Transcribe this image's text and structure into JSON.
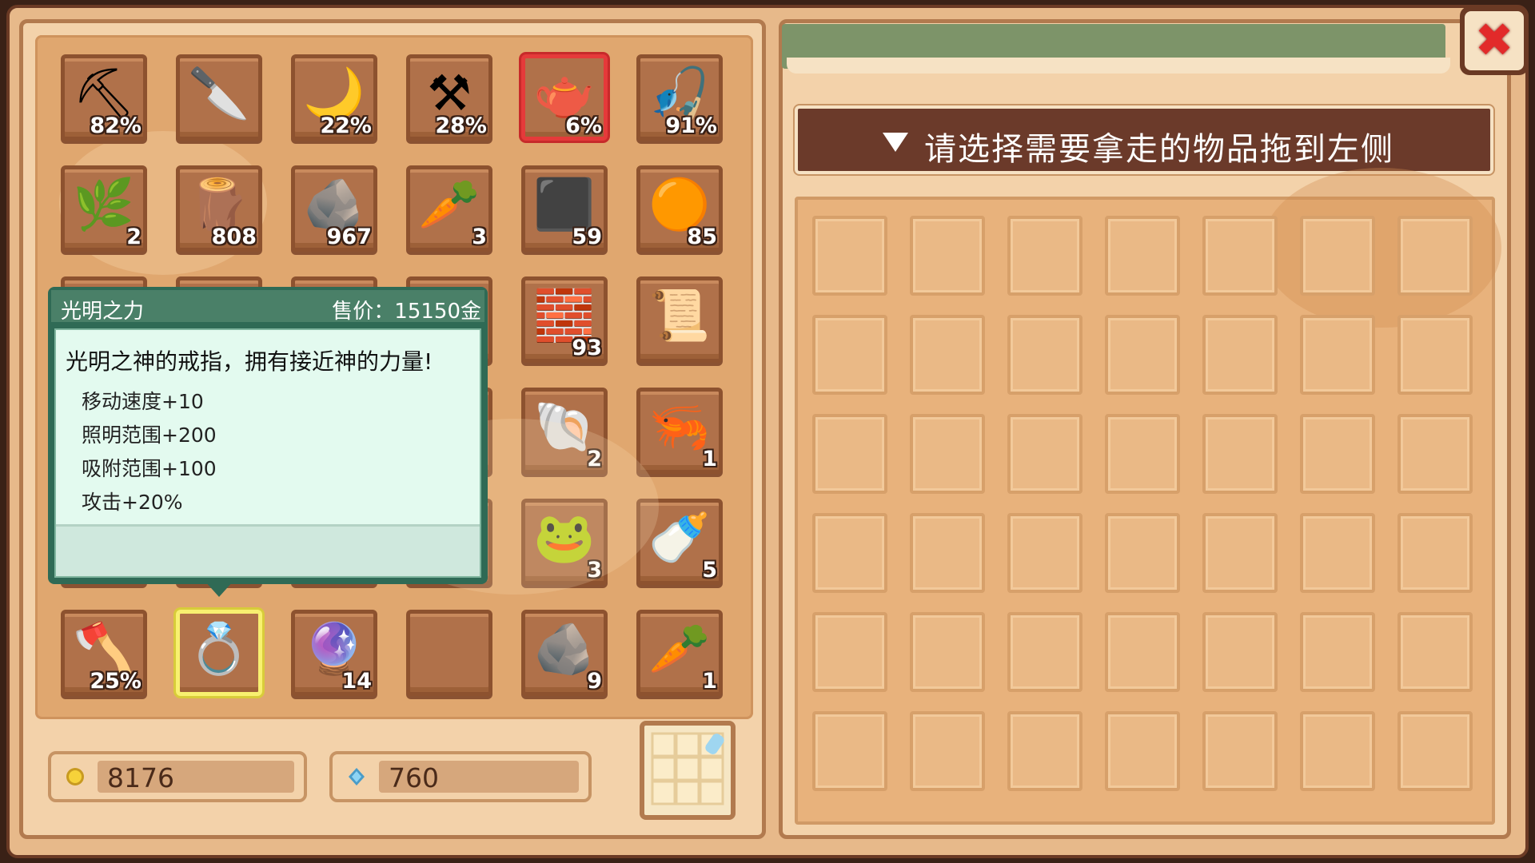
{
  "inventory": {
    "rows": [
      [
        {
          "icon": "pickaxe-icon",
          "glyph": "⛏",
          "qty": "82%",
          "highlight": ""
        },
        {
          "icon": "red-knife-icon",
          "glyph": "🔪",
          "qty": "",
          "highlight": ""
        },
        {
          "icon": "scythe-icon",
          "glyph": "🌙",
          "qty": "22%",
          "highlight": ""
        },
        {
          "icon": "hoe-icon",
          "glyph": "⚒",
          "qty": "28%",
          "highlight": ""
        },
        {
          "icon": "watering-can-icon",
          "glyph": "🫖",
          "qty": "6%",
          "highlight": "red"
        },
        {
          "icon": "fishing-rod-icon",
          "glyph": "🎣",
          "qty": "91%",
          "highlight": ""
        }
      ],
      [
        {
          "icon": "green-vine-icon",
          "glyph": "🌿",
          "qty": "2",
          "highlight": ""
        },
        {
          "icon": "wood-log-icon",
          "glyph": "🪵",
          "qty": "808",
          "highlight": ""
        },
        {
          "icon": "stone-icon",
          "glyph": "🪨",
          "qty": "967",
          "highlight": ""
        },
        {
          "icon": "parsnip-icon",
          "glyph": "🥕",
          "qty": "3",
          "highlight": ""
        },
        {
          "icon": "coal-ore-icon",
          "glyph": "⬛",
          "qty": "59",
          "highlight": ""
        },
        {
          "icon": "copper-ore-icon",
          "glyph": "🟠",
          "qty": "85",
          "highlight": ""
        }
      ],
      [
        {
          "icon": "hidden-slot",
          "glyph": "",
          "qty": "",
          "highlight": ""
        },
        {
          "icon": "hidden-slot",
          "glyph": "",
          "qty": "",
          "highlight": ""
        },
        {
          "icon": "hidden-slot",
          "glyph": "",
          "qty": "",
          "highlight": ""
        },
        {
          "icon": "hidden-slot",
          "glyph": "",
          "qty": "",
          "highlight": ""
        },
        {
          "icon": "wood-plank-icon",
          "glyph": "🧱",
          "qty": "93",
          "highlight": ""
        },
        {
          "icon": "cloth-icon",
          "glyph": "📜",
          "qty": "",
          "highlight": ""
        }
      ],
      [
        {
          "icon": "hidden-slot",
          "glyph": "",
          "qty": "",
          "highlight": ""
        },
        {
          "icon": "hidden-slot",
          "glyph": "",
          "qty": "",
          "highlight": ""
        },
        {
          "icon": "hidden-slot",
          "glyph": "",
          "qty": "",
          "highlight": ""
        },
        {
          "icon": "hidden-slot",
          "glyph": "",
          "qty": "",
          "highlight": ""
        },
        {
          "icon": "crystal-shell-icon",
          "glyph": "🐚",
          "qty": "2",
          "highlight": ""
        },
        {
          "icon": "shrimp-icon",
          "glyph": "🦐",
          "qty": "1",
          "highlight": ""
        }
      ],
      [
        {
          "icon": "hidden-slot",
          "glyph": "",
          "qty": "",
          "highlight": ""
        },
        {
          "icon": "hidden-slot",
          "glyph": "",
          "qty": "",
          "highlight": ""
        },
        {
          "icon": "hidden-slot",
          "glyph": "",
          "qty": "",
          "highlight": ""
        },
        {
          "icon": "hidden-slot",
          "glyph": "",
          "qty": "",
          "highlight": ""
        },
        {
          "icon": "green-monster-icon",
          "glyph": "🐸",
          "qty": "3",
          "highlight": ""
        },
        {
          "icon": "milk-bottle-icon",
          "glyph": "🍼",
          "qty": "5",
          "highlight": ""
        }
      ],
      [
        {
          "icon": "axe-icon",
          "glyph": "🪓",
          "qty": "25%",
          "highlight": ""
        },
        {
          "icon": "emerald-ring-icon",
          "glyph": "💍",
          "qty": "",
          "highlight": "yellow"
        },
        {
          "icon": "purple-orb-icon",
          "glyph": "🔮",
          "qty": "14",
          "highlight": ""
        },
        {
          "icon": "empty-slot",
          "glyph": "",
          "qty": "",
          "highlight": ""
        },
        {
          "icon": "rock-icon",
          "glyph": "🪨",
          "qty": "9",
          "highlight": ""
        },
        {
          "icon": "sparkling-parsnip-icon",
          "glyph": "🥕",
          "qty": "1",
          "highlight": ""
        }
      ]
    ]
  },
  "currency": {
    "gold": "8176",
    "gems": "760"
  },
  "tooltip": {
    "name": "光明之力",
    "price": "售价：15150金",
    "description": "光明之神的戒指，拥有接近神的力量!",
    "stats": [
      "移动速度+10",
      "照明范围+200",
      "吸附范围+100",
      "攻击+20%"
    ]
  },
  "right_panel": {
    "instruction": "请选择需要拿走的物品拖到左侧",
    "grid_rows": 6,
    "grid_cols": 7
  },
  "colors": {
    "close_x": "#e22a2a",
    "gold_coin": "#f6d23a",
    "gem": "#8ed4f4"
  }
}
